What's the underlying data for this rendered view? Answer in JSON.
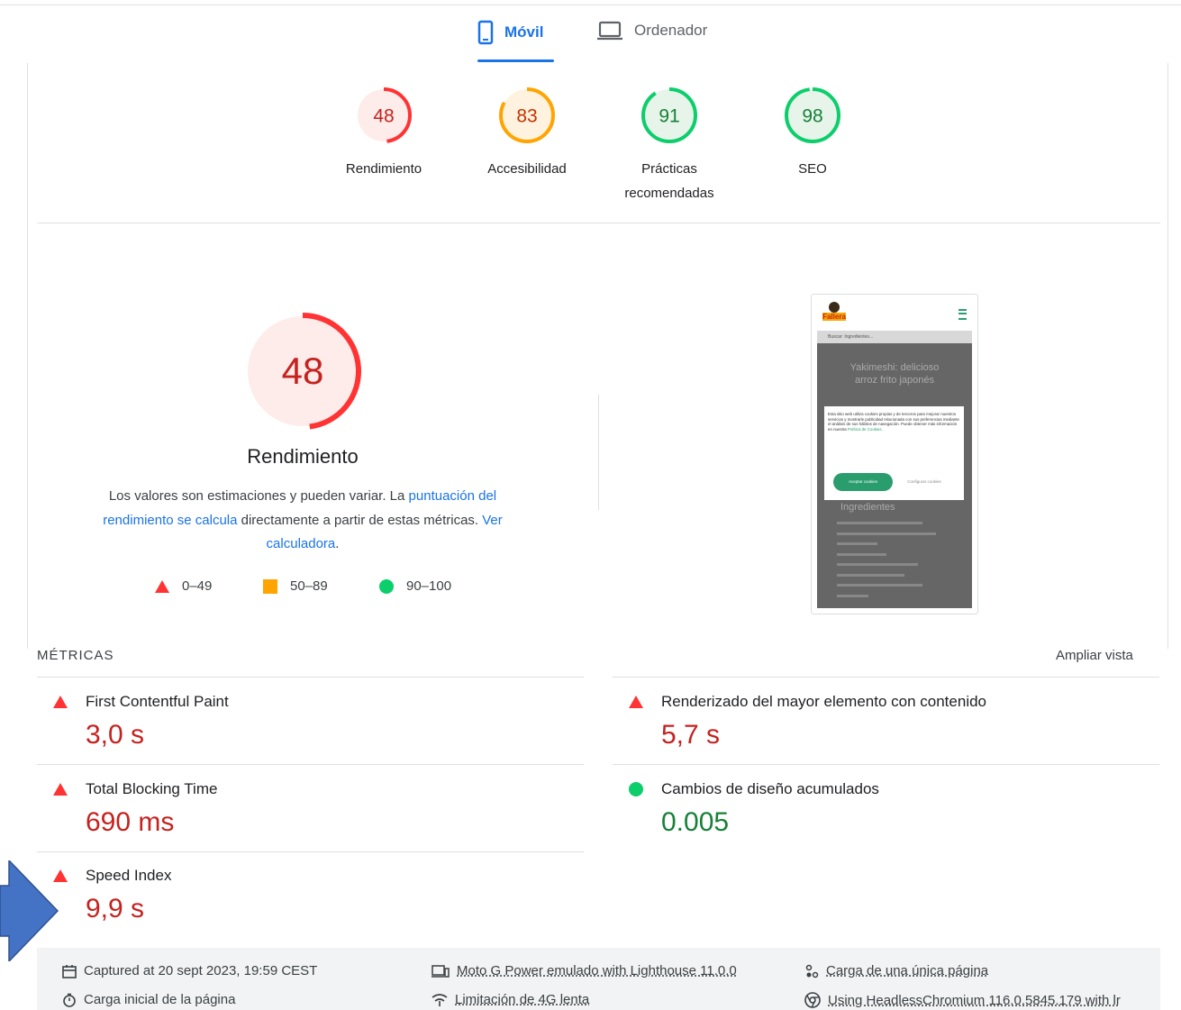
{
  "tabs": {
    "mobile": "Móvil",
    "desktop": "Ordenador"
  },
  "scores": [
    {
      "value": "48",
      "label": "Rendimiento",
      "status": "fail"
    },
    {
      "value": "83",
      "label": "Accesibilidad",
      "status": "average"
    },
    {
      "value": "91",
      "label": "Prácticas recomendadas",
      "status": "pass"
    },
    {
      "value": "98",
      "label": "SEO",
      "status": "pass"
    }
  ],
  "score_fractions": [
    0.48,
    0.83,
    0.91,
    0.98
  ],
  "main": {
    "score": "48",
    "score_fraction": 0.48,
    "title": "Rendimiento",
    "desc_pre": "Los valores son estimaciones y pueden variar. La ",
    "desc_link1": "puntuación del rendimiento se calcula",
    "desc_mid": " directamente a partir de estas métricas. ",
    "desc_link2": "Ver calculadora",
    "desc_end": "."
  },
  "legend": {
    "fail": "0–49",
    "average": "50–89",
    "pass": "90–100"
  },
  "colors": {
    "fail": "#ff3333",
    "average": "#ffa400",
    "pass": "#0cce6b",
    "link": "#1a73e8",
    "fail_text": "#c5221f",
    "pass_text": "#188038"
  },
  "screenshot": {
    "search": "Buscar: Ingredientes...",
    "heading": "Yakimeshi: delicioso arroz frito japonés",
    "cookie_text": "Esta sitio web utiliza cookies propias y de terceros para mejorar nuestros servicios y mostrarle publicidad relacionada con sus preferencias mediante el análisis de sus hábitos de navegación. Puede obtener más información en nuestra",
    "cookie_link": "Política de Cookies.",
    "accept": "Aceptar cookies",
    "configure": "Configurar cookies",
    "ingredients": "Ingredientes",
    "logo": "Fallera"
  },
  "metrics_section": {
    "title": "MÉTRICAS",
    "expand": "Ampliar vista"
  },
  "metrics": [
    {
      "name": "First Contentful Paint",
      "value": "3,0 s",
      "status": "fail"
    },
    {
      "name": "Renderizado del mayor elemento con contenido",
      "value": "5,7 s",
      "status": "fail"
    },
    {
      "name": "Total Blocking Time",
      "value": "690 ms",
      "status": "fail"
    },
    {
      "name": "Cambios de diseño acumulados",
      "value": "0.005",
      "status": "pass"
    },
    {
      "name": "Speed Index",
      "value": "9,9 s",
      "status": "fail"
    }
  ],
  "footer": {
    "captured": "Captured at 20 sept 2023, 19:59 CEST",
    "device": "Moto G Power emulado with Lighthouse 11.0.0",
    "single_page": "Carga de una única página",
    "initial_load": "Carga inicial de la página",
    "throttling": "Limitación de 4G lenta",
    "browser": "Using HeadlessChromium 116.0.5845.179 with lr"
  }
}
